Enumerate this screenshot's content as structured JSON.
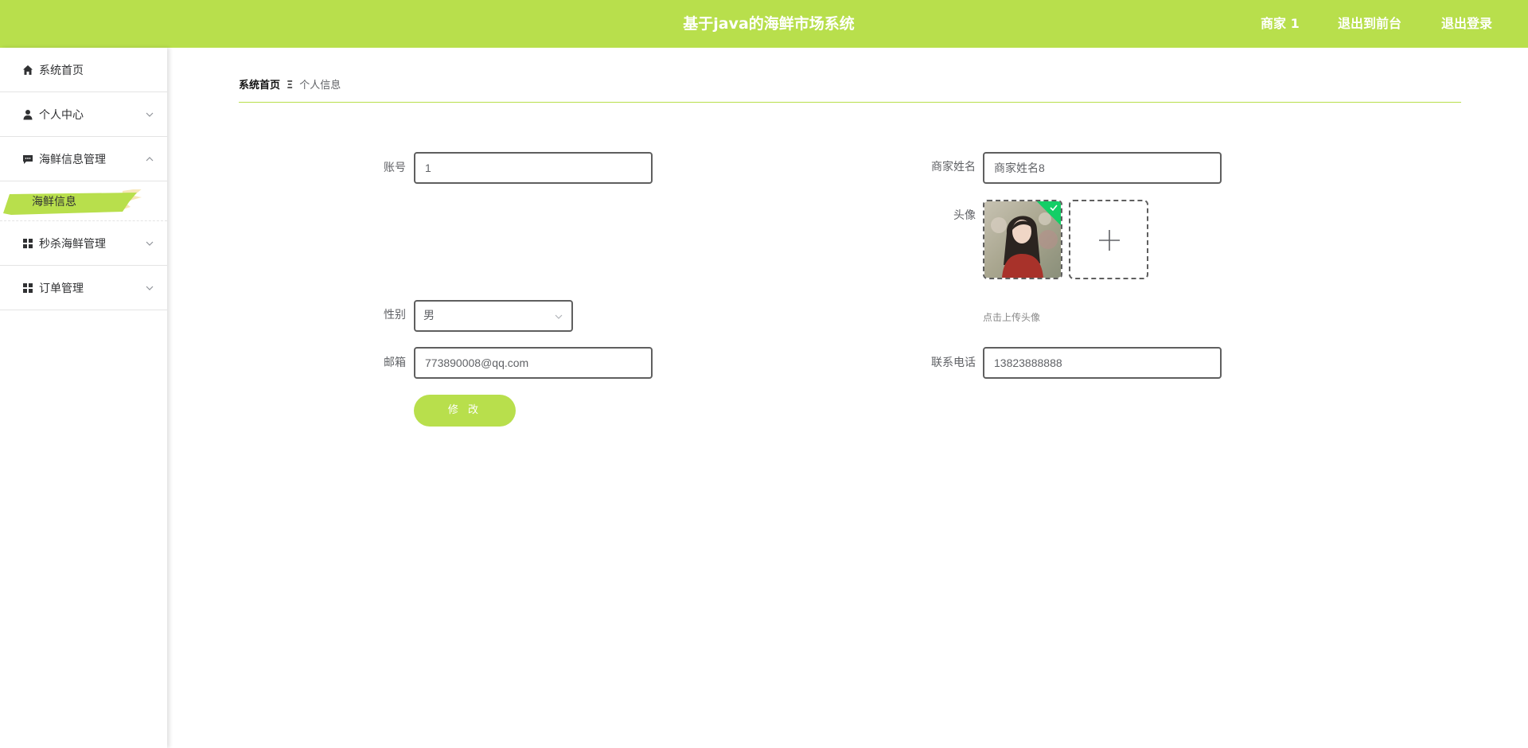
{
  "header": {
    "title": "基于java的海鲜市场系统",
    "user_label": "商家 1",
    "to_frontend_label": "退出到前台",
    "logout_label": "退出登录",
    "accent_color": "#b8df4c"
  },
  "sidebar": {
    "items": [
      {
        "label": "系统首页",
        "icon": "home-icon"
      },
      {
        "label": "个人中心",
        "icon": "user-icon",
        "expanded": false
      },
      {
        "label": "海鲜信息管理",
        "icon": "chat-icon",
        "expanded": true
      },
      {
        "label": "秒杀海鲜管理",
        "icon": "grid-icon",
        "expanded": false
      },
      {
        "label": "订单管理",
        "icon": "grid-icon",
        "expanded": false
      }
    ],
    "active_subitem": "海鲜信息"
  },
  "breadcrumb": {
    "home": "系统首页",
    "separator": "Ξ",
    "current": "个人信息"
  },
  "form": {
    "account_label": "账号",
    "account_value": "1",
    "merchant_name_label": "商家姓名",
    "merchant_name_value": "商家姓名8",
    "avatar_label": "头像",
    "upload_tip": "点击上传头像",
    "gender_label": "性别",
    "gender_value": "男",
    "email_label": "邮箱",
    "email_value": "773890008@qq.com",
    "phone_label": "联系电话",
    "phone_value": "13823888888",
    "submit_label": "修 改"
  }
}
